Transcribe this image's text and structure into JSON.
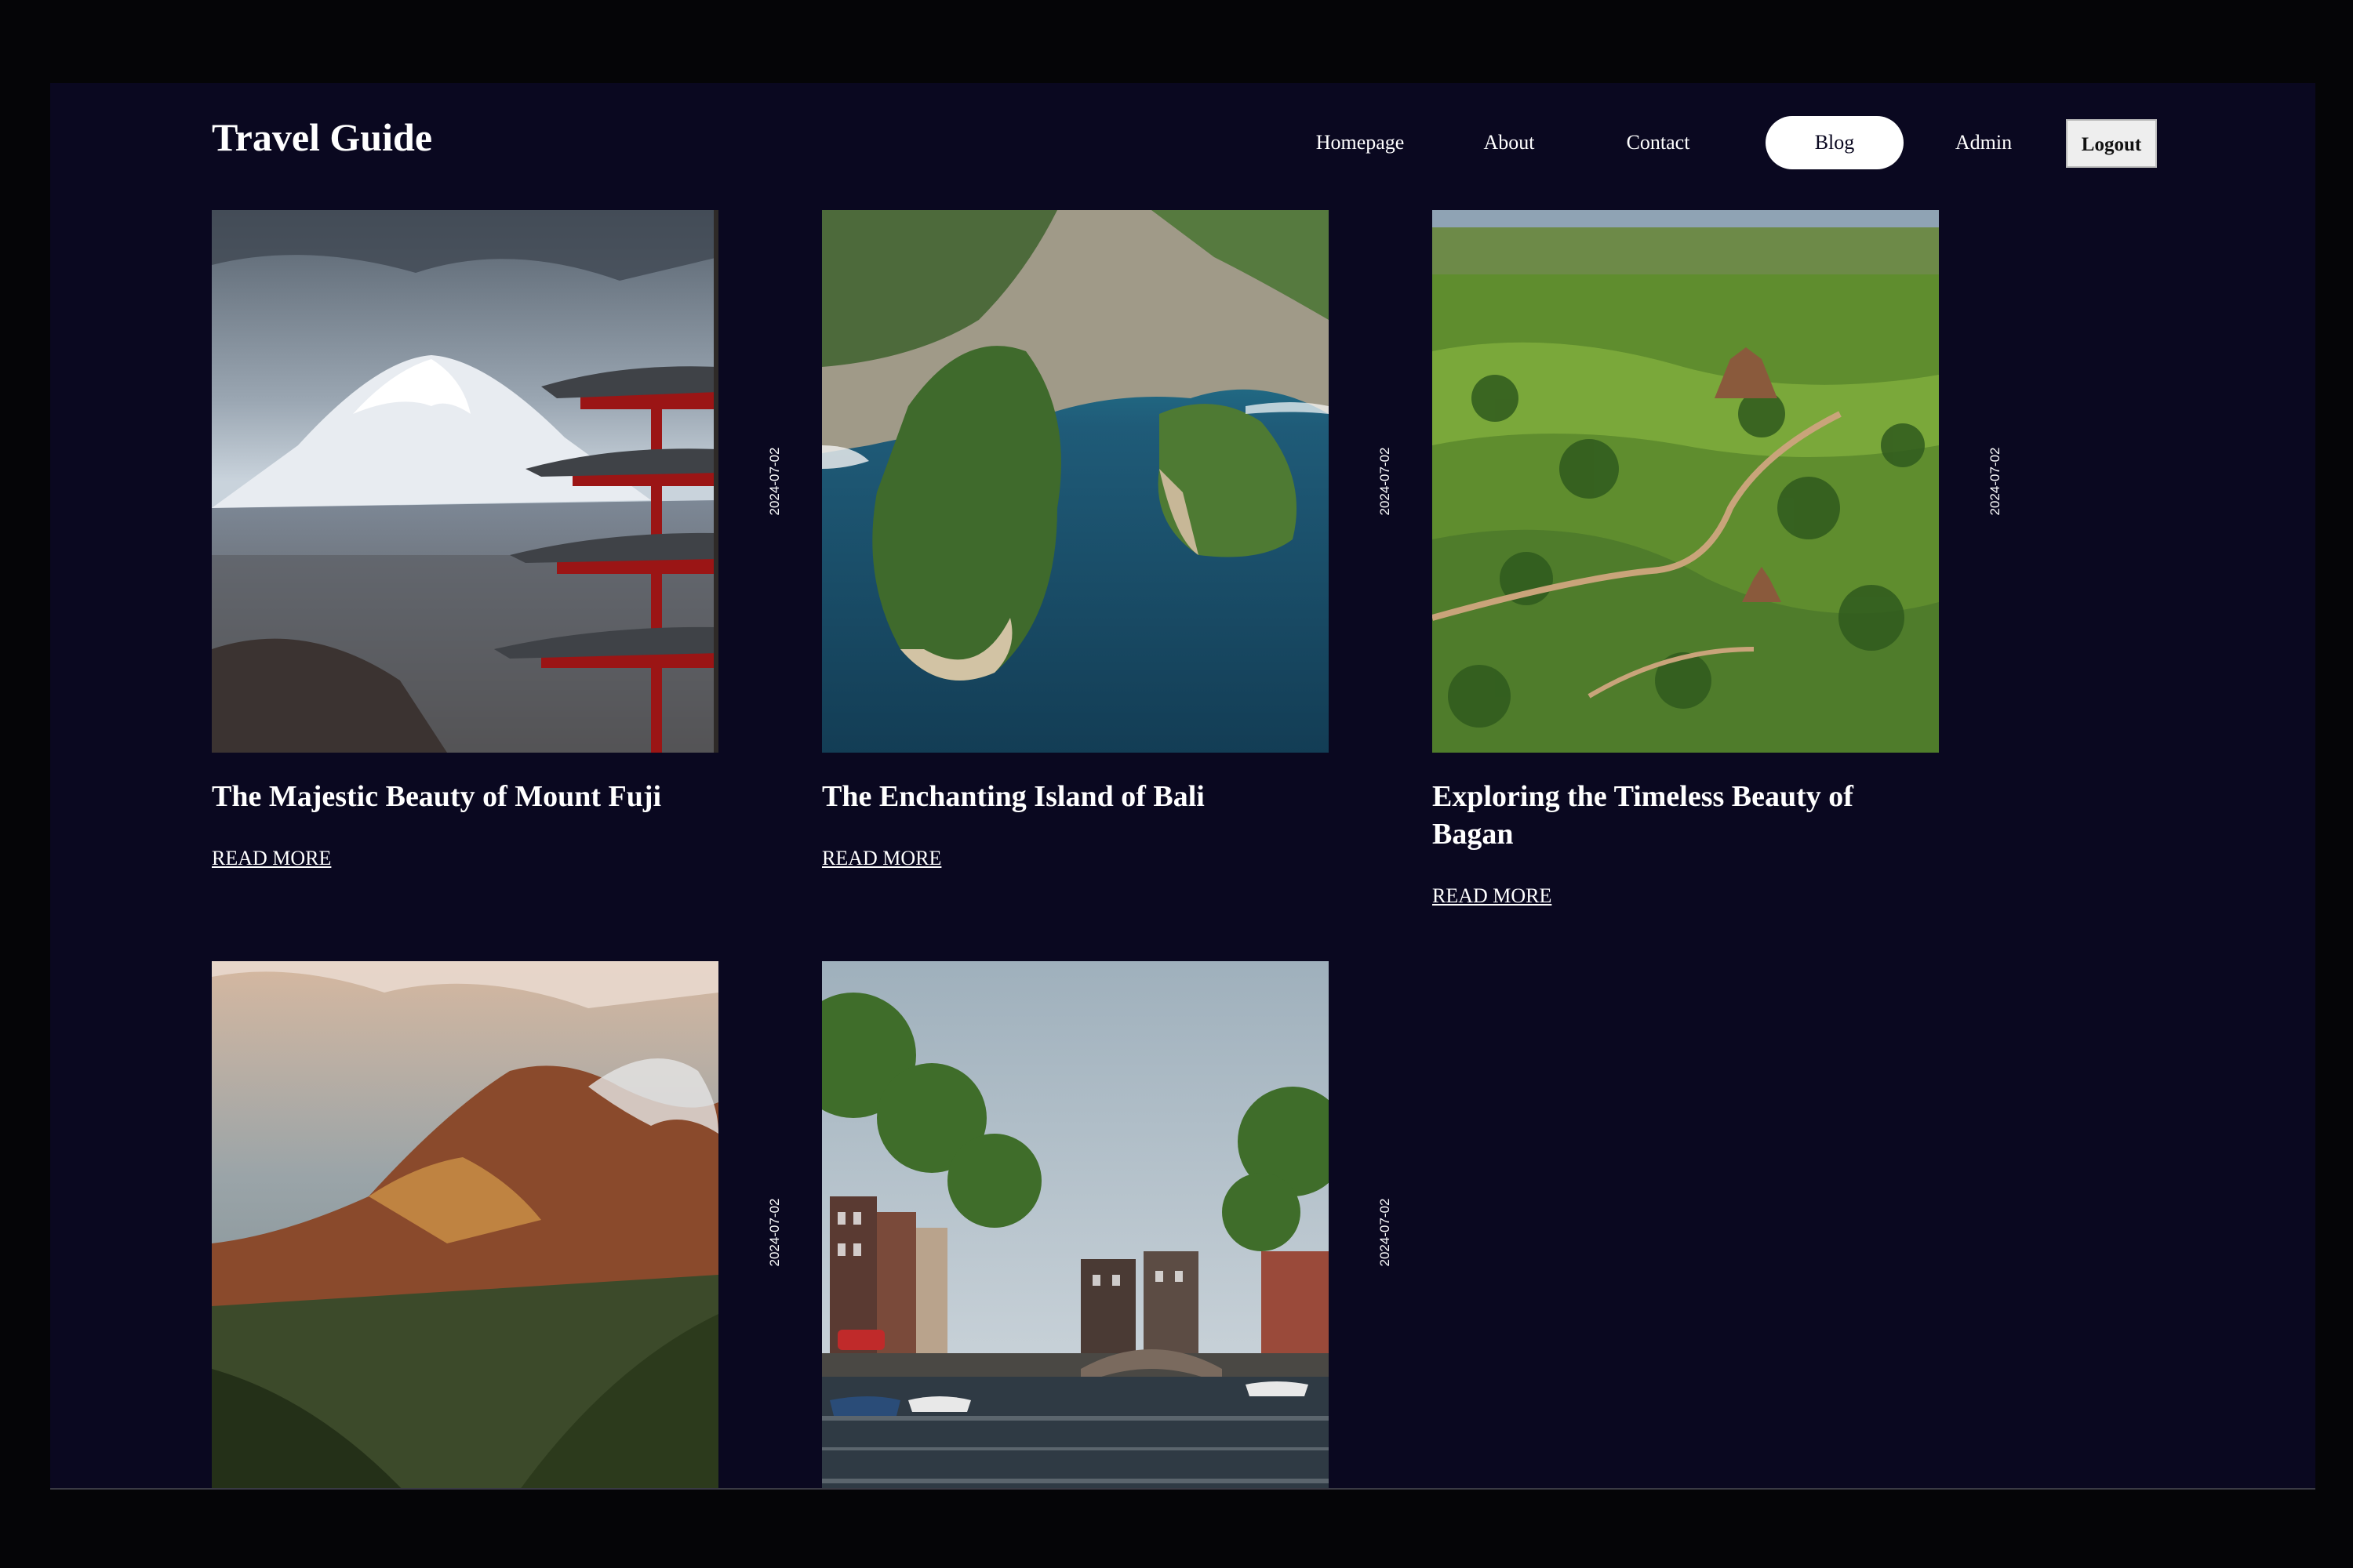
{
  "header": {
    "logo": "Travel Guide",
    "nav": {
      "homepage": "Homepage",
      "about": "About",
      "contact": "Contact",
      "blog": "Blog",
      "admin": "Admin",
      "logout": "Logout"
    },
    "active_nav": "Blog"
  },
  "posts": [
    {
      "title": "The Majestic Beauty of Mount Fuji",
      "date": "2024-07-02",
      "link": "READ MORE",
      "image": "mount-fuji-pagoda-photo"
    },
    {
      "title": "The Enchanting Island of Bali",
      "date": "2024-07-02",
      "link": "READ MORE",
      "image": "bali-sea-cliffs-photo"
    },
    {
      "title": "Exploring the Timeless Beauty of Bagan",
      "date": "2024-07-02",
      "link": "READ MORE",
      "image": "bagan-temples-aerial-photo"
    },
    {
      "title": "",
      "date": "2024-07-02",
      "link": "",
      "image": "mountain-valley-cliffs-photo"
    },
    {
      "title": "",
      "date": "2024-07-02",
      "link": "",
      "image": "amsterdam-canal-photo"
    }
  ],
  "colors": {
    "page_background": "#0a0820",
    "outer_background": "#050507",
    "text": "#ffffff",
    "active_nav_background": "#ffffff",
    "logout_background": "#eeeeee"
  }
}
